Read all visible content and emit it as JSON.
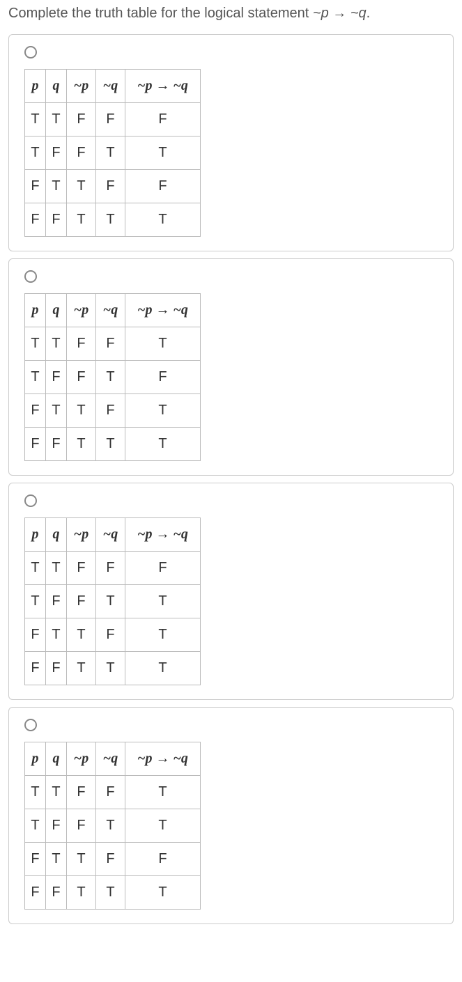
{
  "question_prefix": "Complete the truth table for the logical statement ",
  "question_expr": "~p → ~q",
  "question_suffix": ".",
  "headers": {
    "p": "p",
    "q": "q",
    "np": "~p",
    "nq": "~q",
    "res": "~p → ~q"
  },
  "options": [
    {
      "rows": [
        {
          "p": "T",
          "q": "T",
          "np": "F",
          "nq": "F",
          "res": "F"
        },
        {
          "p": "T",
          "q": "F",
          "np": "F",
          "nq": "T",
          "res": "T"
        },
        {
          "p": "F",
          "q": "T",
          "np": "T",
          "nq": "F",
          "res": "F"
        },
        {
          "p": "F",
          "q": "F",
          "np": "T",
          "nq": "T",
          "res": "T"
        }
      ]
    },
    {
      "rows": [
        {
          "p": "T",
          "q": "T",
          "np": "F",
          "nq": "F",
          "res": "T"
        },
        {
          "p": "T",
          "q": "F",
          "np": "F",
          "nq": "T",
          "res": "F"
        },
        {
          "p": "F",
          "q": "T",
          "np": "T",
          "nq": "F",
          "res": "T"
        },
        {
          "p": "F",
          "q": "F",
          "np": "T",
          "nq": "T",
          "res": "T"
        }
      ]
    },
    {
      "rows": [
        {
          "p": "T",
          "q": "T",
          "np": "F",
          "nq": "F",
          "res": "F"
        },
        {
          "p": "T",
          "q": "F",
          "np": "F",
          "nq": "T",
          "res": "T"
        },
        {
          "p": "F",
          "q": "T",
          "np": "T",
          "nq": "F",
          "res": "T"
        },
        {
          "p": "F",
          "q": "F",
          "np": "T",
          "nq": "T",
          "res": "T"
        }
      ]
    },
    {
      "rows": [
        {
          "p": "T",
          "q": "T",
          "np": "F",
          "nq": "F",
          "res": "T"
        },
        {
          "p": "T",
          "q": "F",
          "np": "F",
          "nq": "T",
          "res": "T"
        },
        {
          "p": "F",
          "q": "T",
          "np": "T",
          "nq": "F",
          "res": "F"
        },
        {
          "p": "F",
          "q": "F",
          "np": "T",
          "nq": "T",
          "res": "T"
        }
      ]
    }
  ]
}
